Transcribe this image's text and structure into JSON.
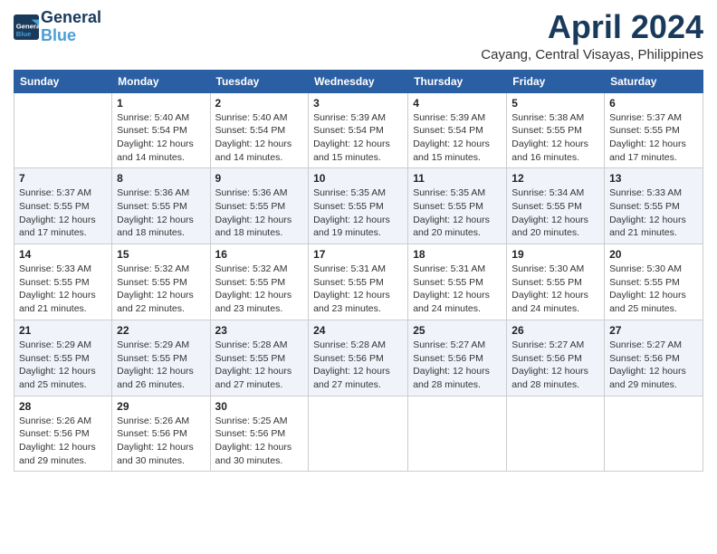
{
  "header": {
    "logo_line1": "General",
    "logo_line2": "Blue",
    "month": "April 2024",
    "location": "Cayang, Central Visayas, Philippines"
  },
  "weekdays": [
    "Sunday",
    "Monday",
    "Tuesday",
    "Wednesday",
    "Thursday",
    "Friday",
    "Saturday"
  ],
  "weeks": [
    [
      {
        "day": "",
        "info": ""
      },
      {
        "day": "1",
        "info": "Sunrise: 5:40 AM\nSunset: 5:54 PM\nDaylight: 12 hours\nand 14 minutes."
      },
      {
        "day": "2",
        "info": "Sunrise: 5:40 AM\nSunset: 5:54 PM\nDaylight: 12 hours\nand 14 minutes."
      },
      {
        "day": "3",
        "info": "Sunrise: 5:39 AM\nSunset: 5:54 PM\nDaylight: 12 hours\nand 15 minutes."
      },
      {
        "day": "4",
        "info": "Sunrise: 5:39 AM\nSunset: 5:54 PM\nDaylight: 12 hours\nand 15 minutes."
      },
      {
        "day": "5",
        "info": "Sunrise: 5:38 AM\nSunset: 5:55 PM\nDaylight: 12 hours\nand 16 minutes."
      },
      {
        "day": "6",
        "info": "Sunrise: 5:37 AM\nSunset: 5:55 PM\nDaylight: 12 hours\nand 17 minutes."
      }
    ],
    [
      {
        "day": "7",
        "info": "Sunrise: 5:37 AM\nSunset: 5:55 PM\nDaylight: 12 hours\nand 17 minutes."
      },
      {
        "day": "8",
        "info": "Sunrise: 5:36 AM\nSunset: 5:55 PM\nDaylight: 12 hours\nand 18 minutes."
      },
      {
        "day": "9",
        "info": "Sunrise: 5:36 AM\nSunset: 5:55 PM\nDaylight: 12 hours\nand 18 minutes."
      },
      {
        "day": "10",
        "info": "Sunrise: 5:35 AM\nSunset: 5:55 PM\nDaylight: 12 hours\nand 19 minutes."
      },
      {
        "day": "11",
        "info": "Sunrise: 5:35 AM\nSunset: 5:55 PM\nDaylight: 12 hours\nand 20 minutes."
      },
      {
        "day": "12",
        "info": "Sunrise: 5:34 AM\nSunset: 5:55 PM\nDaylight: 12 hours\nand 20 minutes."
      },
      {
        "day": "13",
        "info": "Sunrise: 5:33 AM\nSunset: 5:55 PM\nDaylight: 12 hours\nand 21 minutes."
      }
    ],
    [
      {
        "day": "14",
        "info": "Sunrise: 5:33 AM\nSunset: 5:55 PM\nDaylight: 12 hours\nand 21 minutes."
      },
      {
        "day": "15",
        "info": "Sunrise: 5:32 AM\nSunset: 5:55 PM\nDaylight: 12 hours\nand 22 minutes."
      },
      {
        "day": "16",
        "info": "Sunrise: 5:32 AM\nSunset: 5:55 PM\nDaylight: 12 hours\nand 23 minutes."
      },
      {
        "day": "17",
        "info": "Sunrise: 5:31 AM\nSunset: 5:55 PM\nDaylight: 12 hours\nand 23 minutes."
      },
      {
        "day": "18",
        "info": "Sunrise: 5:31 AM\nSunset: 5:55 PM\nDaylight: 12 hours\nand 24 minutes."
      },
      {
        "day": "19",
        "info": "Sunrise: 5:30 AM\nSunset: 5:55 PM\nDaylight: 12 hours\nand 24 minutes."
      },
      {
        "day": "20",
        "info": "Sunrise: 5:30 AM\nSunset: 5:55 PM\nDaylight: 12 hours\nand 25 minutes."
      }
    ],
    [
      {
        "day": "21",
        "info": "Sunrise: 5:29 AM\nSunset: 5:55 PM\nDaylight: 12 hours\nand 25 minutes."
      },
      {
        "day": "22",
        "info": "Sunrise: 5:29 AM\nSunset: 5:55 PM\nDaylight: 12 hours\nand 26 minutes."
      },
      {
        "day": "23",
        "info": "Sunrise: 5:28 AM\nSunset: 5:55 PM\nDaylight: 12 hours\nand 27 minutes."
      },
      {
        "day": "24",
        "info": "Sunrise: 5:28 AM\nSunset: 5:56 PM\nDaylight: 12 hours\nand 27 minutes."
      },
      {
        "day": "25",
        "info": "Sunrise: 5:27 AM\nSunset: 5:56 PM\nDaylight: 12 hours\nand 28 minutes."
      },
      {
        "day": "26",
        "info": "Sunrise: 5:27 AM\nSunset: 5:56 PM\nDaylight: 12 hours\nand 28 minutes."
      },
      {
        "day": "27",
        "info": "Sunrise: 5:27 AM\nSunset: 5:56 PM\nDaylight: 12 hours\nand 29 minutes."
      }
    ],
    [
      {
        "day": "28",
        "info": "Sunrise: 5:26 AM\nSunset: 5:56 PM\nDaylight: 12 hours\nand 29 minutes."
      },
      {
        "day": "29",
        "info": "Sunrise: 5:26 AM\nSunset: 5:56 PM\nDaylight: 12 hours\nand 30 minutes."
      },
      {
        "day": "30",
        "info": "Sunrise: 5:25 AM\nSunset: 5:56 PM\nDaylight: 12 hours\nand 30 minutes."
      },
      {
        "day": "",
        "info": ""
      },
      {
        "day": "",
        "info": ""
      },
      {
        "day": "",
        "info": ""
      },
      {
        "day": "",
        "info": ""
      }
    ]
  ]
}
